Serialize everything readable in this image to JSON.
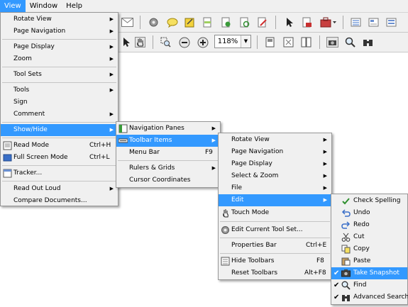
{
  "menubar": {
    "items": [
      {
        "label": "View",
        "active": true
      },
      {
        "label": "Window",
        "active": false
      },
      {
        "label": "Help",
        "active": false
      }
    ]
  },
  "toolbar": {
    "zoom_value": "118%",
    "zoom_dropdown_glyph": "▼"
  },
  "view_menu": {
    "items": [
      {
        "label": "Rotate View",
        "submenu": true
      },
      {
        "label": "Page Navigation",
        "submenu": true
      },
      {
        "label": "Page Display",
        "submenu": true
      },
      {
        "label": "Zoom",
        "submenu": true
      },
      {
        "label": "Tool Sets",
        "submenu": true
      },
      {
        "label": "Tools",
        "submenu": true
      },
      {
        "label": "Sign",
        "submenu": false
      },
      {
        "label": "Comment",
        "submenu": true
      },
      {
        "label": "Show/Hide",
        "submenu": true,
        "highlighted": true
      },
      {
        "label": "Read Mode",
        "shortcut": "Ctrl+H",
        "icon": "read-mode-icon"
      },
      {
        "label": "Full Screen Mode",
        "shortcut": "Ctrl+L",
        "icon": "full-screen-icon"
      },
      {
        "label": "Tracker...",
        "icon": "tracker-icon"
      },
      {
        "label": "Read Out Loud",
        "submenu": true
      },
      {
        "label": "Compare Documents...",
        "submenu": false
      }
    ]
  },
  "showhide_menu": {
    "items": [
      {
        "label": "Navigation Panes",
        "submenu": true,
        "icon": "navigation-panes-icon"
      },
      {
        "label": "Toolbar Items",
        "submenu": true,
        "icon": "toolbar-items-icon",
        "highlighted": true
      },
      {
        "label": "Menu Bar",
        "shortcut": "F9"
      },
      {
        "label": "Rulers & Grids",
        "submenu": true
      },
      {
        "label": "Cursor Coordinates"
      }
    ]
  },
  "toolbar_items_menu": {
    "items": [
      {
        "label": "Rotate View",
        "submenu": true
      },
      {
        "label": "Page Navigation",
        "submenu": true
      },
      {
        "label": "Page Display",
        "submenu": true
      },
      {
        "label": "Select & Zoom",
        "submenu": true
      },
      {
        "label": "File",
        "submenu": true
      },
      {
        "label": "Edit",
        "submenu": true,
        "highlighted": true
      },
      {
        "label": "Touch Mode",
        "icon": "touch-mode-icon"
      },
      {
        "label": "Edit Current Tool Set...",
        "icon": "gear-icon"
      },
      {
        "label": "Properties Bar",
        "shortcut": "Ctrl+E"
      },
      {
        "label": "Hide Toolbars",
        "shortcut": "F8",
        "icon": "hide-toolbars-icon"
      },
      {
        "label": "Reset Toolbars",
        "shortcut": "Alt+F8"
      }
    ]
  },
  "edit_menu": {
    "items": [
      {
        "label": "Check Spelling",
        "icon": "check-spelling-icon"
      },
      {
        "label": "Undo",
        "icon": "undo-icon"
      },
      {
        "label": "Redo",
        "icon": "redo-icon"
      },
      {
        "label": "Cut",
        "icon": "scissors-icon"
      },
      {
        "label": "Copy",
        "icon": "copy-icon"
      },
      {
        "label": "Paste",
        "icon": "paste-icon"
      },
      {
        "label": "Take Snapshot",
        "icon": "camera-icon",
        "checked": true,
        "highlighted": true
      },
      {
        "label": "Find",
        "icon": "magnifier-icon",
        "checked": true
      },
      {
        "label": "Advanced Search",
        "icon": "binoculars-icon",
        "checked": true
      }
    ]
  },
  "colors": {
    "highlight": "#3399ff",
    "menu_bg": "#f0f0f0",
    "toolbar_bg": "#f0f0f0"
  }
}
